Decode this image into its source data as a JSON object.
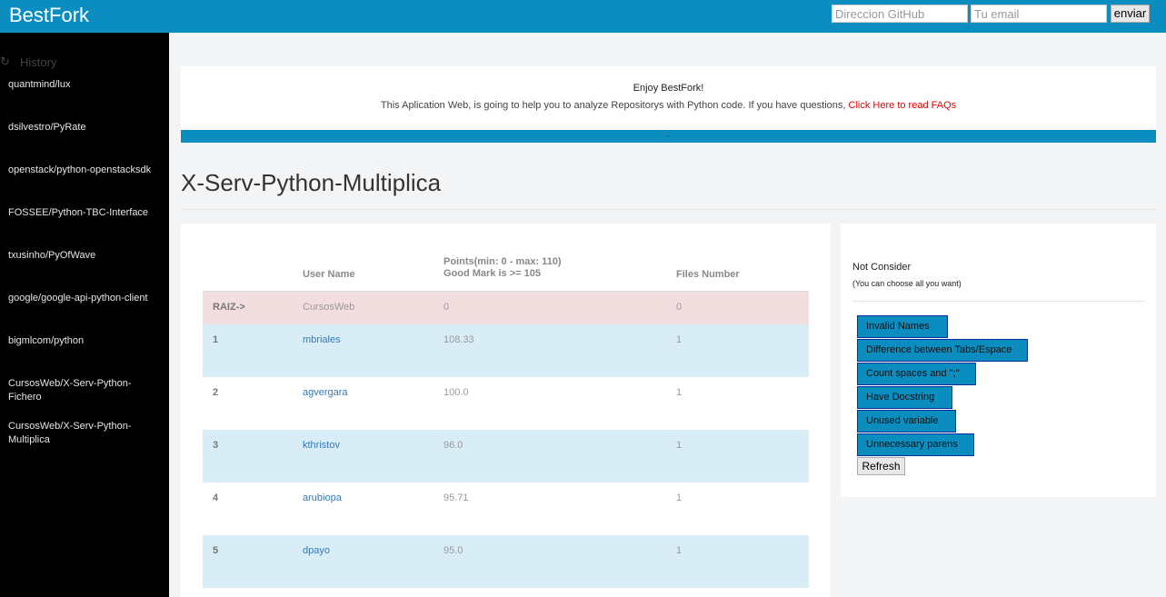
{
  "header": {
    "brand": "BestFork",
    "github_placeholder": "Direccion GitHub",
    "email_placeholder": "Tu email",
    "send_label": "enviar"
  },
  "sidebar": {
    "history_icon": "refresh-icon",
    "history_label": "History",
    "items": [
      "quantmind/lux",
      "dsilvestro/PyRate",
      "openstack/python-openstacksdk",
      "FOSSEE/Python-TBC-Interface",
      "txusinho/PyOfWave",
      "google/google-api-python-client",
      "bigmlcom/python",
      "CursosWeb/X-Serv-Python-Fichero",
      "CursosWeb/X-Serv-Python-Multiplica"
    ]
  },
  "banner": {
    "headline": "Enjoy BestFork!",
    "text": "This Aplication Web, is going to help you to analyze Repositorys with Python code. If you have questions, ",
    "link": "Click Here to read FAQs",
    "bar_dot": "."
  },
  "main": {
    "title": "X-Serv-Python-Multiplica"
  },
  "table": {
    "headers": {
      "user": "User Name",
      "points_line1": "Points(min: 0 - max: 110)",
      "points_line2": "Good Mark is >= 105",
      "files": "Files Number"
    },
    "rows": [
      {
        "num": "RAIZ->",
        "user": "CursosWeb",
        "points": "0",
        "files": "0",
        "style": "raiz"
      },
      {
        "num": "1",
        "user": "mbriales",
        "points": "108.33",
        "files": "1",
        "style": "info"
      },
      {
        "num": "2",
        "user": "agvergara",
        "points": "100.0",
        "files": "1",
        "style": "plain"
      },
      {
        "num": "3",
        "user": "kthristov",
        "points": "96.0",
        "files": "1",
        "style": "info"
      },
      {
        "num": "4",
        "user": "arubiopa",
        "points": "95.71",
        "files": "1",
        "style": "plain"
      },
      {
        "num": "5",
        "user": "dpayo",
        "points": "95.0",
        "files": "1",
        "style": "info"
      }
    ]
  },
  "filters": {
    "title": "Not Consider",
    "subtitle": "(You can choose all you want)",
    "options": [
      "Invalid Names",
      "Difference between Tabs/Espace",
      "Count spaces and \";\"",
      "Have Docstring",
      "Unused variable",
      "Unnecessary parens"
    ],
    "refresh_label": "Refresh"
  },
  "colors": {
    "accent": "#0c8dbf",
    "sidebar_bg": "#000000",
    "link": "#337ab7",
    "faq_link": "#e30000",
    "raiz_row": "#f2dede",
    "info_row": "#d9edf7"
  }
}
